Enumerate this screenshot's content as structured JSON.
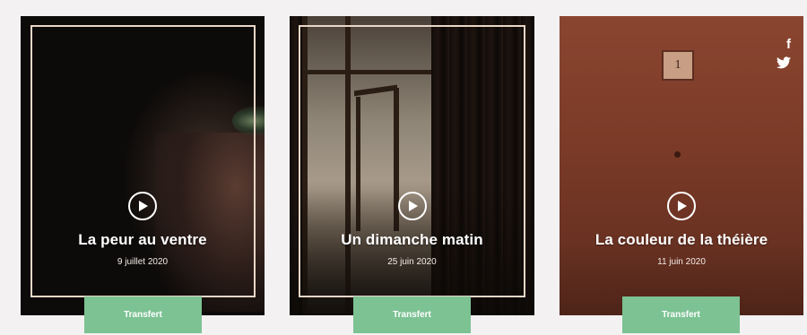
{
  "episodes": [
    {
      "title": "La peur au ventre",
      "date": "9 juillet 2020",
      "button_label": "Transfert"
    },
    {
      "title": "Un dimanche matin",
      "date": "25 juin 2020",
      "button_label": "Transfert"
    },
    {
      "title": "La couleur de la théière",
      "date": "11 juin 2020",
      "button_label": "Transfert"
    }
  ],
  "social": {
    "facebook_glyph": "f",
    "facebook_icon": "facebook-icon",
    "twitter_icon": "twitter-icon"
  },
  "decor": {
    "box_number": "1"
  },
  "colors": {
    "button": "#7cc293",
    "frame": "#e9d6c7",
    "card3": "#7e3b28"
  }
}
